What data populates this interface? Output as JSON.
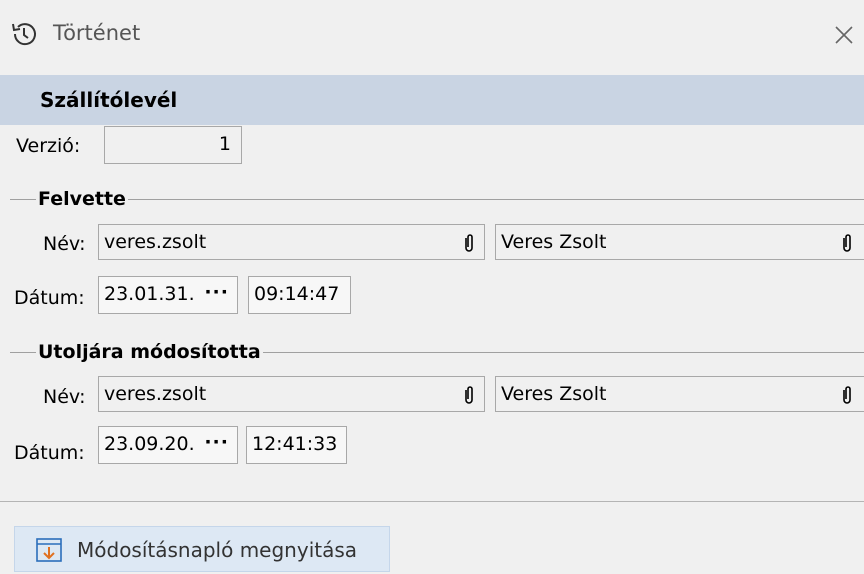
{
  "window": {
    "title": "Történet",
    "close_icon": "close-icon",
    "history_icon": "history-icon"
  },
  "section": {
    "title": "Szállítólevél"
  },
  "version": {
    "label": "Verzió:",
    "value": "1"
  },
  "created": {
    "group_title": "Felvette",
    "name_label": "Név:",
    "username": "veres.zsolt",
    "fullname": "Veres Zsolt",
    "date_label": "Dátum:",
    "date": "23.01.31.",
    "time": "09:14:47"
  },
  "modified": {
    "group_title": "Utoljára módosította",
    "name_label": "Név:",
    "username": "veres.zsolt",
    "fullname": "Veres Zsolt",
    "date_label": "Dátum:",
    "date": "23.09.20.",
    "time": "12:41:33"
  },
  "footer": {
    "open_log_label": "Módosításnapló megnyitása",
    "open_log_icon": "download-log-icon"
  },
  "colors": {
    "header_bg": "#c9d4e3",
    "button_bg": "#dde8f4",
    "icon_accent": "#e07020"
  }
}
